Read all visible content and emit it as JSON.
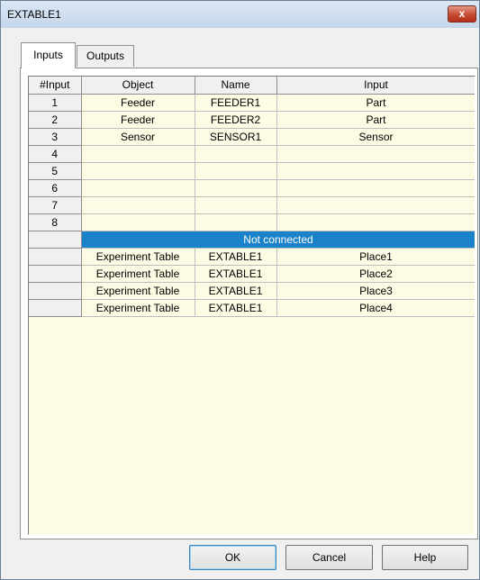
{
  "window": {
    "title": "EXTABLE1",
    "close_label": "x"
  },
  "tabs": [
    {
      "label": "Inputs",
      "active": true
    },
    {
      "label": "Outputs",
      "active": false
    }
  ],
  "grid": {
    "columns": [
      "#Input",
      "Object",
      "Name",
      "Input"
    ],
    "rows": [
      [
        "1",
        "Feeder",
        "FEEDER1",
        "Part"
      ],
      [
        "2",
        "Feeder",
        "FEEDER2",
        "Part"
      ],
      [
        "3",
        "Sensor",
        "SENSOR1",
        "Sensor"
      ],
      [
        "4",
        "",
        "",
        ""
      ],
      [
        "5",
        "",
        "",
        ""
      ],
      [
        "6",
        "",
        "",
        ""
      ],
      [
        "7",
        "",
        "",
        ""
      ],
      [
        "8",
        "",
        "",
        ""
      ]
    ],
    "not_connected_label": "Not connected",
    "unconnected_rows": [
      [
        "",
        "Experiment Table",
        "EXTABLE1",
        "Place1"
      ],
      [
        "",
        "Experiment Table",
        "EXTABLE1",
        "Place2"
      ],
      [
        "",
        "Experiment Table",
        "EXTABLE1",
        "Place3"
      ],
      [
        "",
        "Experiment Table",
        "EXTABLE1",
        "Place4"
      ]
    ]
  },
  "buttons": {
    "ok": "OK",
    "cancel": "Cancel",
    "help": "Help"
  },
  "colors": {
    "selection": "#1a82c8",
    "cell_background": "#fdfbe3"
  }
}
